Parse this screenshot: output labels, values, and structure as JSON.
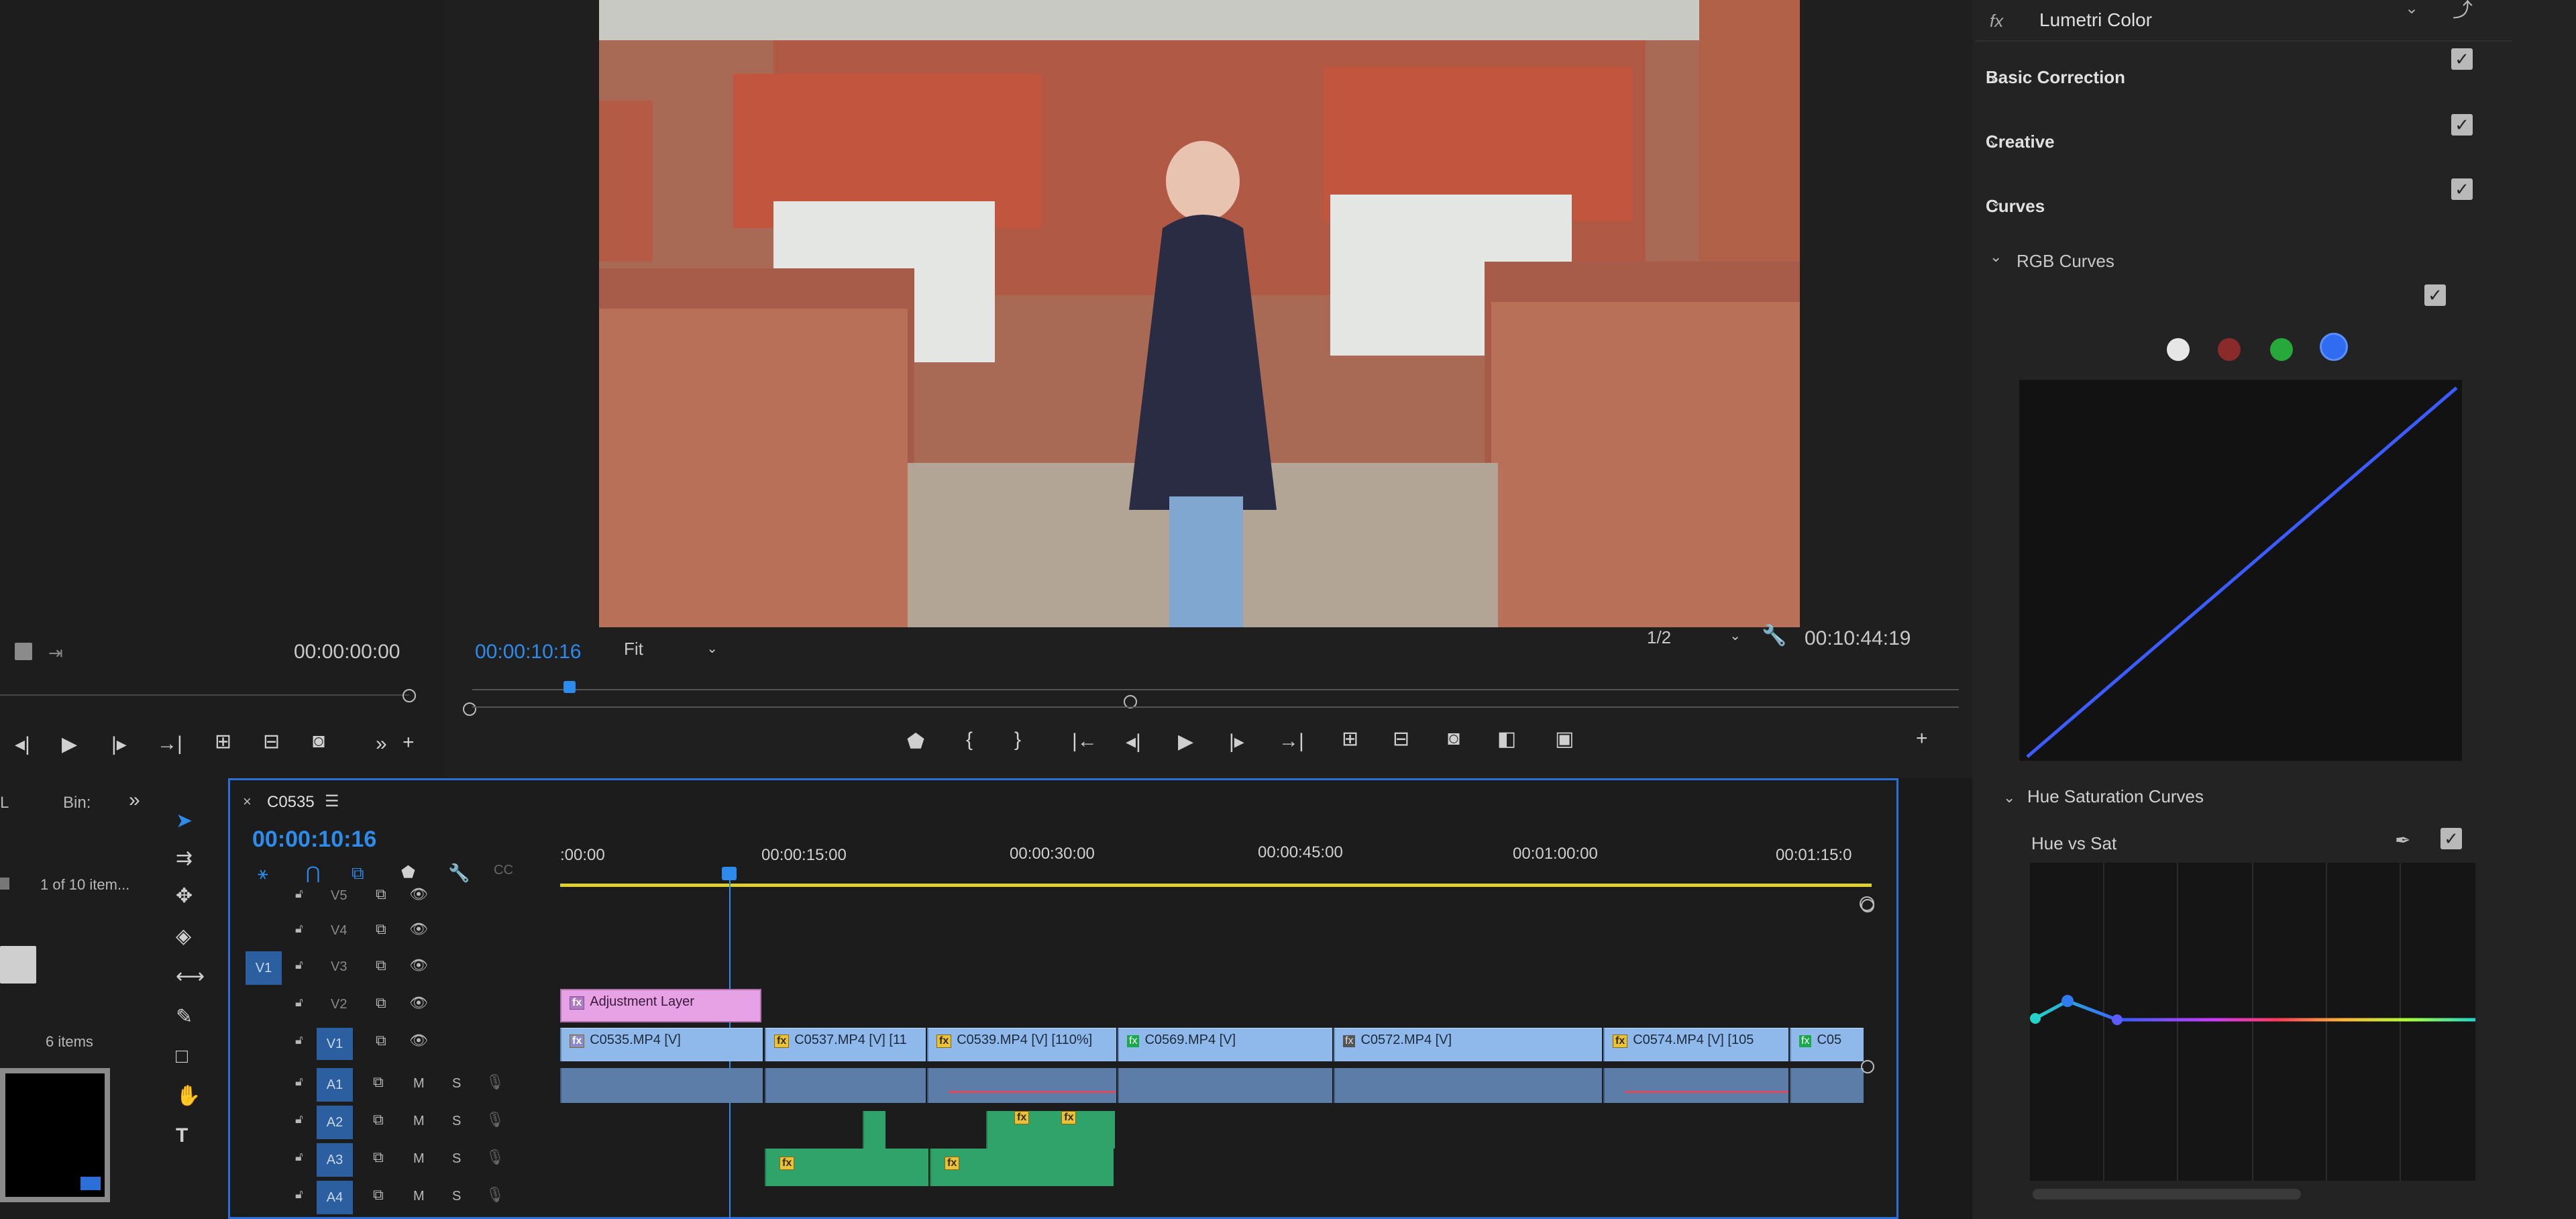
{
  "source_monitor": {
    "timecode": "00:00:00:00"
  },
  "program_monitor": {
    "timecode": "00:00:10:16",
    "zoom": "Fit",
    "resolution": "1/2",
    "duration": "00:10:44:19"
  },
  "project_panel": {
    "tab_l": "L",
    "tab_bin": "Bin:",
    "item_count": "1 of 10 item...",
    "bin_items": "6 items"
  },
  "timeline": {
    "tab": "C0535",
    "timecode": "00:00:10:16",
    "ruler": [
      ":00:00",
      "00:00:15:00",
      "00:00:30:00",
      "00:00:45:00",
      "00:01:00:00",
      "00:01:15:0"
    ],
    "video_tracks": [
      "V5",
      "V4",
      "V3",
      "V2",
      "V1"
    ],
    "source_patch": "V1",
    "audio_tracks": [
      "A1",
      "A2",
      "A3",
      "A4"
    ],
    "m_label": "M",
    "s_label": "S",
    "clips": {
      "adjustment": "Adjustment Layer",
      "c0535": "C0535.MP4 [V]",
      "c0537": "C0537.MP4 [V] [11",
      "c0539": "C0539.MP4 [V] [110%]",
      "c0569": "C0569.MP4 [V]",
      "c0572": "C0572.MP4 [V]",
      "c0574": "C0574.MP4 [V] [105",
      "c05": "C05"
    }
  },
  "lumetri": {
    "title": "Lumetri Color",
    "fx": "fx",
    "sections": {
      "basic": "Basic Correction",
      "creative": "Creative",
      "curves": "Curves",
      "rgb": "RGB Curves",
      "hue_sat": "Hue Saturation Curves",
      "hue_vs_sat": "Hue vs Sat"
    },
    "colors": {
      "white": "#e6e6e6",
      "red": "#8a2a2a",
      "green": "#27a83a",
      "blue": "#2f6cf0",
      "curve": "#3b5cff"
    }
  }
}
